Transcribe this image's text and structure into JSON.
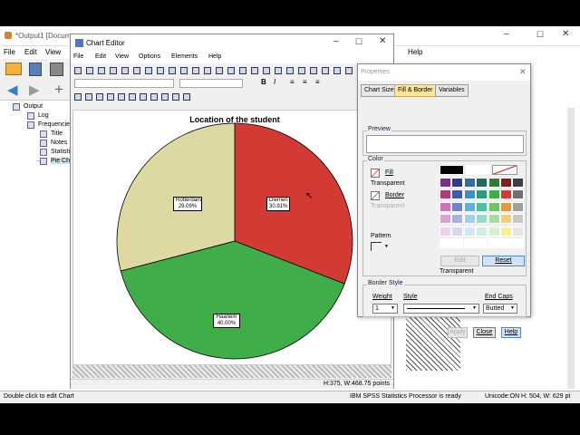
{
  "viewer": {
    "title": "*Output1 [Docume",
    "menu": [
      "File",
      "Edit",
      "View"
    ],
    "help": "Help",
    "tree": [
      "Output",
      "Log",
      "Frequencie",
      "Title",
      "Notes",
      "Statisti",
      "Pie Ch"
    ]
  },
  "chart_editor": {
    "title": "Chart Editor",
    "menu": [
      "File",
      "Edit",
      "View",
      "Options",
      "Elements",
      "Help"
    ],
    "status": "H:375, W:468.75 points"
  },
  "chart_data": {
    "type": "pie",
    "title": "Location of the student",
    "categories": [
      "Diemen",
      "Haarlem",
      "Rotterdam"
    ],
    "values": [
      30.91,
      40.0,
      29.09
    ],
    "labels": [
      "30.91%",
      "40.00%",
      "29.09%"
    ],
    "colors": [
      "#d33a33",
      "#3fae49",
      "#ded9a3"
    ]
  },
  "properties": {
    "title": "Properties",
    "tabs": [
      "Chart Size",
      "Fill & Border",
      "Variables"
    ],
    "preview_label": "Preview",
    "color_label": "Color",
    "fill_label": "Fill",
    "fill_value": "Transparent",
    "border_label": "Border",
    "border_value": "Transparent",
    "pattern_label": "Pattern",
    "edit_button": "Edit",
    "reset_button": "Reset",
    "transparent_label": "Transparent",
    "border_style_label": "Border Style",
    "weight_label": "Weight",
    "weight_value": "1",
    "style_label": "Style",
    "endcaps_label": "End Caps",
    "endcaps_value": "Butted",
    "apply_button": "Apply",
    "close_button": "Close",
    "help_button": "Help",
    "palette": [
      "#000000",
      "#ffffff",
      "#ffffff",
      "#ffffff",
      "#ffffff",
      "#ffffff",
      "#7a2d8c",
      "#2c3c8f",
      "#2d6ea3",
      "#1f6b5a",
      "#2f7d2f",
      "#8a1b1b",
      "#404040",
      "#b03c7a",
      "#3f5bb5",
      "#3e8fc7",
      "#2f9a7e",
      "#3fae49",
      "#d33a33",
      "#707070",
      "#c974b7",
      "#7083d0",
      "#5ab0e0",
      "#4cc0a0",
      "#6cc160",
      "#e9963a",
      "#a0a0a0",
      "#d9a3d3",
      "#a6b2e6",
      "#9dd1f1",
      "#96dcc8",
      "#a9dda0",
      "#f7ce6b",
      "#c8c8c8",
      "#ecd2ec",
      "#d3d9f4",
      "#cfe8f8",
      "#cdeee5",
      "#d6efd0",
      "#fbf08a",
      "#e5e5e5",
      "#ffffff",
      "#ffffff",
      "#ffffff",
      "#ffffff",
      "#ffffff",
      "#ffffff",
      "#ffffff"
    ]
  },
  "status_bar": {
    "left": "Double click to edit Chart",
    "processor": "IBM SPSS Statistics Processor is ready",
    "unicode": "Unicode:ON",
    "size": "H: 504, W: 629 pt"
  }
}
